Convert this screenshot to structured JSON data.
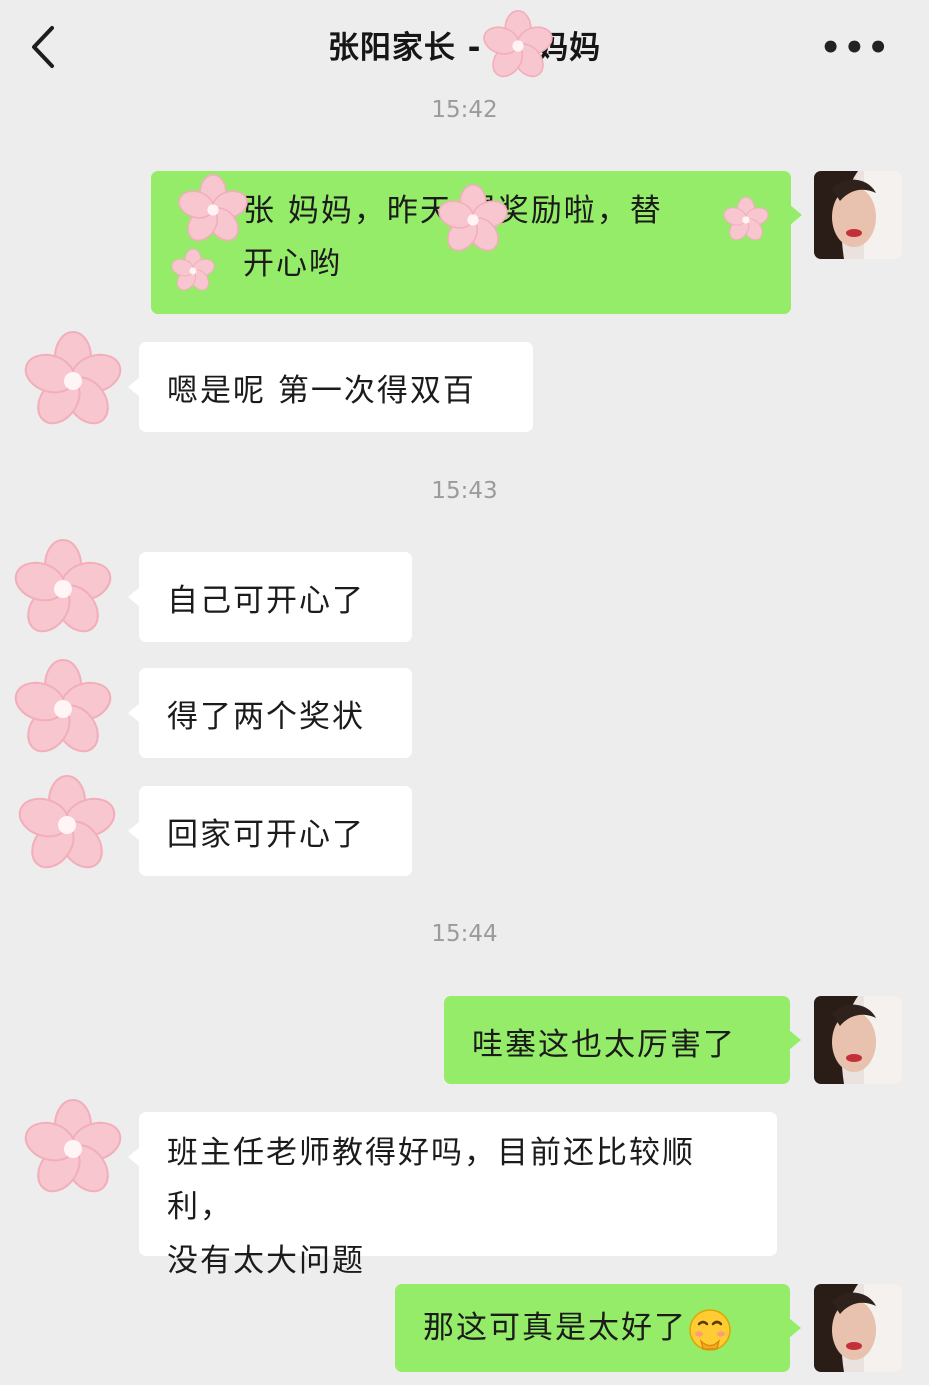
{
  "header": {
    "title": "张阳家长 - 张 妈妈",
    "more_icon": "more-dots-icon",
    "back_icon": "chevron-left-icon"
  },
  "timestamps": [
    "15:42",
    "15:43",
    "15:44"
  ],
  "messages": [
    {
      "side": "out",
      "line1": "张 妈妈，昨天 得奖励啦，替 ",
      "line2": " 开心哟"
    },
    {
      "side": "in",
      "text": "嗯是呢 第一次得双百"
    },
    {
      "side": "in",
      "text": "自己可开心了"
    },
    {
      "side": "in",
      "text": "得了两个奖状"
    },
    {
      "side": "in",
      "text": "回家可开心了"
    },
    {
      "side": "out",
      "text": "哇塞这也太厉害了"
    },
    {
      "side": "in",
      "line1": "班主任老师教得好吗，目前还比较顺利，",
      "line2": "没有太大问题"
    },
    {
      "side": "out",
      "text": "那这可真是太好了"
    }
  ],
  "colors": {
    "background": "#ededed",
    "bubble_in": "#ffffff",
    "bubble_out": "#95ec69",
    "timestamp": "#9b9b9b",
    "flower_petal": "#f7c6cf"
  },
  "icons": {
    "contact_avatar": "pink-flower-icon",
    "self_avatar": "user-photo-avatar",
    "emoji": "shushing-face-emoji"
  }
}
